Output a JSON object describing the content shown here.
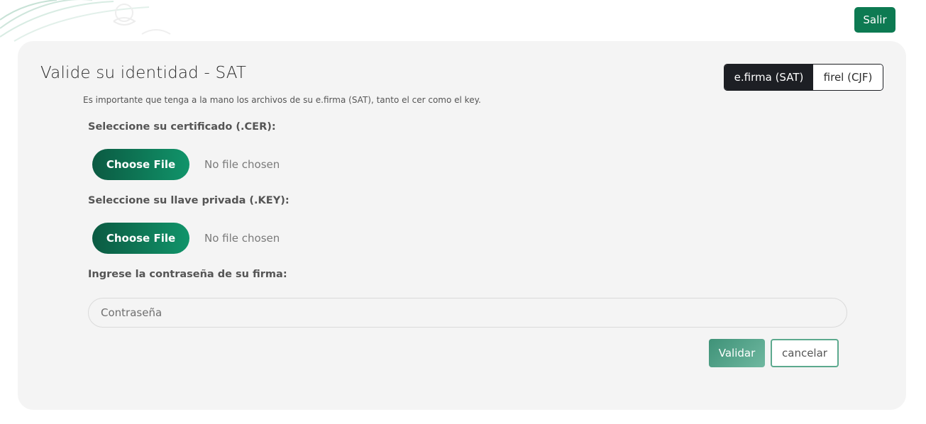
{
  "header": {
    "exit_label": "Salir"
  },
  "form": {
    "title": "Valide su identidad - SAT",
    "subtitle": "Es importante que tenga a la mano los archivos de su e.firma (SAT), tanto el cer como el key.",
    "toggle": {
      "options": [
        "e.firma (SAT)",
        "firel (CJF)"
      ],
      "selected": "e.firma (SAT)"
    },
    "certificate": {
      "label": "Seleccione su certificado (.CER):",
      "button_label": "Choose File",
      "status": "No file chosen"
    },
    "private_key": {
      "label": "Seleccione su llave privada (.KEY):",
      "button_label": "Choose File",
      "status": "No file chosen"
    },
    "password": {
      "label": "Ingrese la contraseña de su firma:",
      "placeholder": "Contraseña",
      "value": ""
    },
    "actions": {
      "submit_label": "Validar",
      "cancel_label": "cancelar"
    }
  },
  "colors": {
    "brand_green": "#0d7a52",
    "toggle_active": "#1d1f24",
    "card_background": "#f4f4f4"
  }
}
